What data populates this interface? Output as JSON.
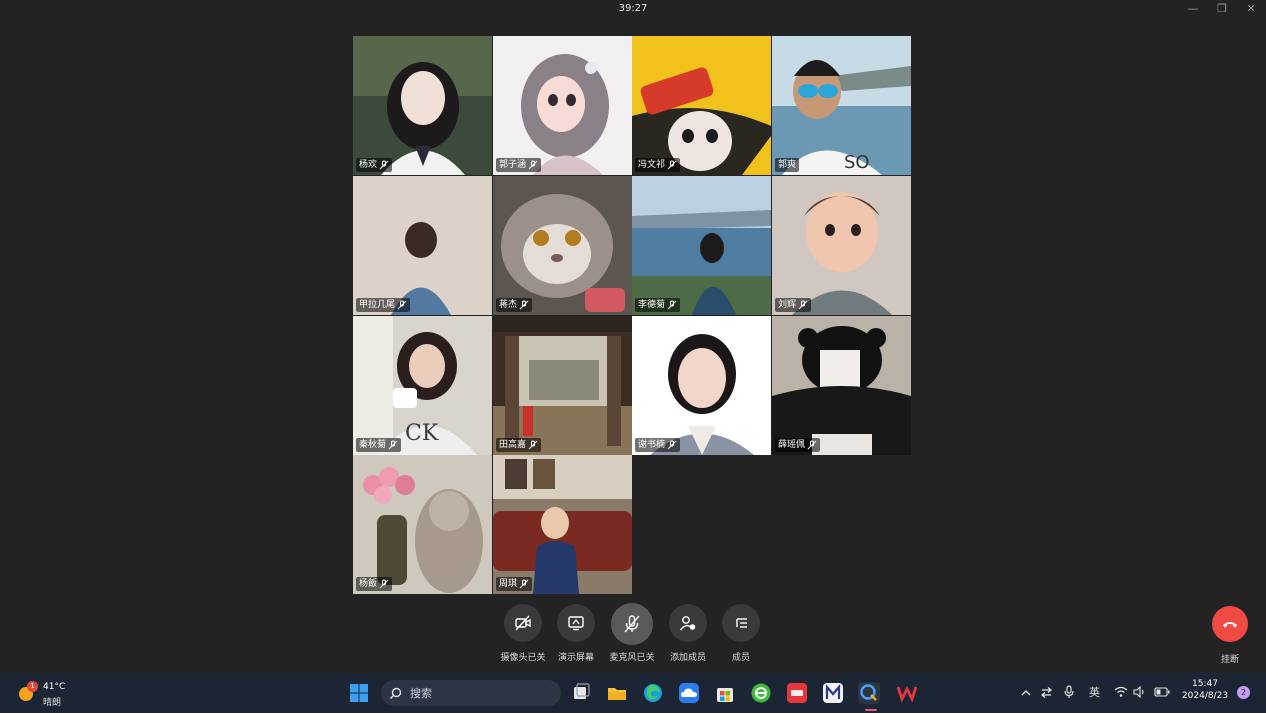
{
  "titlebar": {
    "timer": "39:27"
  },
  "participants": [
    {
      "name": "杨欢",
      "active": false
    },
    {
      "name": "郭子涵",
      "active": false
    },
    {
      "name": "冯文祁",
      "active": false
    },
    {
      "name": "郭爽",
      "active": true
    },
    {
      "name": "甲拉几尾",
      "active": false
    },
    {
      "name": "蒋杰",
      "active": false
    },
    {
      "name": "李德菊",
      "active": false
    },
    {
      "name": "刘辉",
      "active": false
    },
    {
      "name": "秦秋菊",
      "active": false
    },
    {
      "name": "田高嘉",
      "active": false
    },
    {
      "name": "谢书楠",
      "active": false
    },
    {
      "name": "薛瑶佩",
      "active": false
    },
    {
      "name": "杨飯",
      "active": false
    },
    {
      "name": "周琪",
      "active": false
    }
  ],
  "controls": {
    "camera": "摄像头已关",
    "share": "演示屏幕",
    "mic": "麦克风已关",
    "add": "添加成员",
    "members": "成员",
    "hangup": "挂断"
  },
  "taskbar": {
    "weather_badge": "1",
    "temperature": "41°C",
    "condition": "晴朗",
    "search_placeholder": "搜索",
    "ime": "英",
    "time": "15:47",
    "date": "2024/8/23",
    "notification_count": "2"
  },
  "colors": {
    "background": "#232323",
    "active_speaker": "#2fd14a",
    "hangup": "#f04a43",
    "taskbar": "#1c2533"
  }
}
